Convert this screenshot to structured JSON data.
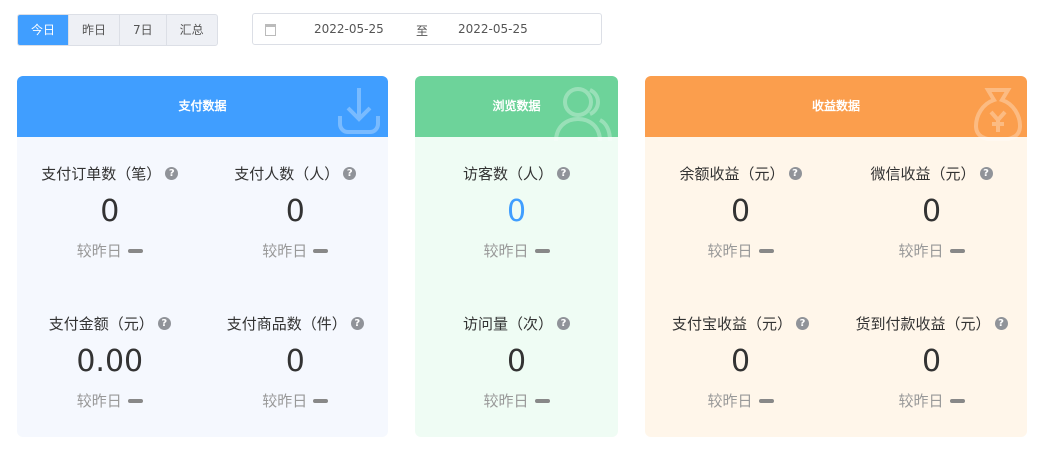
{
  "tabs": [
    "今日",
    "昨日",
    "7日",
    "汇总"
  ],
  "date_range": {
    "start": "2022-05-25",
    "separator": "至",
    "end": "2022-05-25"
  },
  "compare_label": "较昨日",
  "cards": [
    {
      "title": "支付数据",
      "color": "#409eff",
      "body": "#f5f8fe",
      "metrics": [
        {
          "label": "支付订单数（笔）",
          "value": "0"
        },
        {
          "label": "支付人数（人）",
          "value": "0"
        },
        {
          "label": "支付金额（元）",
          "value": "0.00"
        },
        {
          "label": "支付商品数（件）",
          "value": "0"
        }
      ]
    },
    {
      "title": "浏览数据",
      "color": "#6dd39a",
      "body": "#effcf4",
      "metrics": [
        {
          "label": "访客数（人）",
          "value": "0"
        },
        {
          "label": "访问量（次）",
          "value": "0"
        }
      ]
    },
    {
      "title": "收益数据",
      "color": "#fb9e4d",
      "body": "#fff6ea",
      "metrics": [
        {
          "label": "余额收益（元）",
          "value": "0"
        },
        {
          "label": "微信收益（元）",
          "value": "0"
        },
        {
          "label": "支付宝收益（元）",
          "value": "0"
        },
        {
          "label": "货到付款收益（元）",
          "value": "0"
        }
      ]
    }
  ]
}
